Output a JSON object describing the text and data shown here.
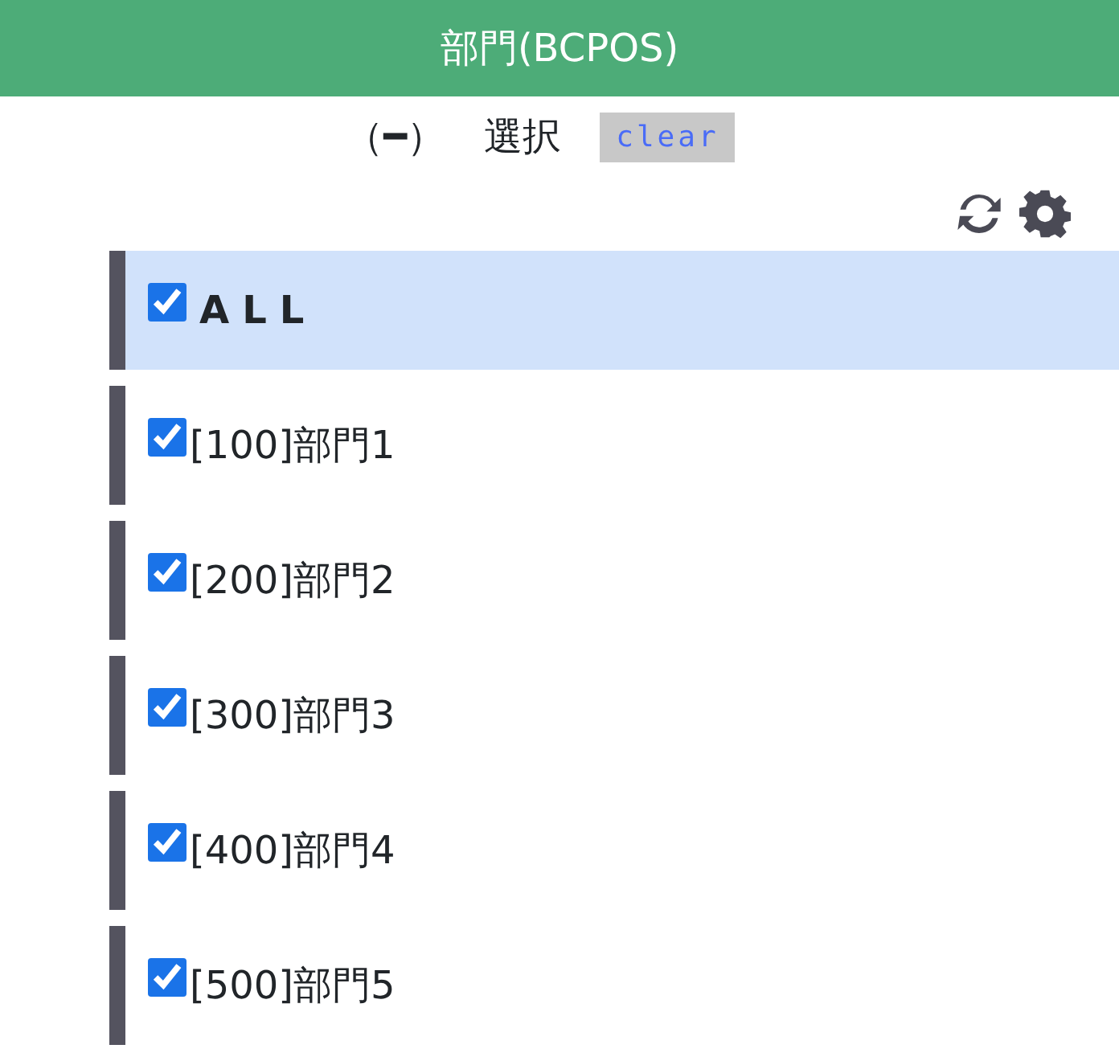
{
  "header": {
    "title": "部門(BCPOS)"
  },
  "selection": {
    "indicator": "（━）",
    "label": "選択",
    "clear_button": "clear"
  },
  "toolbar": {
    "icons": [
      {
        "kind": "refresh"
      },
      {
        "kind": "settings"
      }
    ]
  },
  "items": [
    {
      "label": "ALL",
      "checked": true,
      "selected": true,
      "kind": "all"
    },
    {
      "label": "[100]部門1",
      "checked": true,
      "selected": false,
      "kind": "item"
    },
    {
      "label": "[200]部門2",
      "checked": true,
      "selected": false,
      "kind": "item"
    },
    {
      "label": "[300]部門3",
      "checked": true,
      "selected": false,
      "kind": "item"
    },
    {
      "label": "[400]部門4",
      "checked": true,
      "selected": false,
      "kind": "item"
    },
    {
      "label": "[500]部門5",
      "checked": true,
      "selected": false,
      "kind": "item"
    }
  ]
}
